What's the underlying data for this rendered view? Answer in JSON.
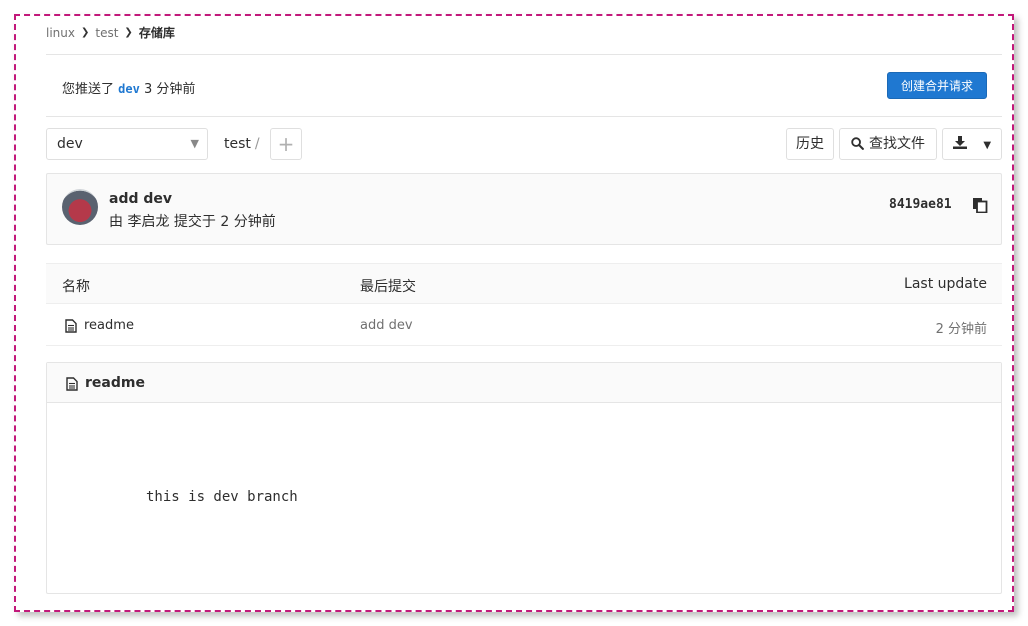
{
  "breadcrumb": {
    "items": [
      "linux",
      "test"
    ],
    "current": "存储库"
  },
  "push_notice": {
    "prefix": "您推送了",
    "branch": "dev",
    "suffix": "3 分钟前"
  },
  "merge_request_button": "创建合并请求",
  "branch_selector": {
    "value": "dev"
  },
  "path": {
    "project": "test",
    "separator": "/"
  },
  "toolbar": {
    "history": "历史",
    "find_file": "查找文件"
  },
  "icons": {
    "search": "search-icon",
    "download": "download-icon",
    "copy": "copy-icon",
    "file": "file-icon",
    "plus": "plus-icon",
    "chevron": "chevron-down-icon"
  },
  "last_commit": {
    "title": "add dev",
    "meta": "由 李启龙 提交于 2 分钟前",
    "sha": "8419ae81"
  },
  "file_table": {
    "headers": [
      "名称",
      "最后提交",
      "Last update"
    ],
    "rows": [
      {
        "name": "readme",
        "commit": "add dev",
        "updated": "2 分钟前"
      }
    ]
  },
  "readme": {
    "title": "readme",
    "content": "this is dev branch"
  },
  "colors": {
    "accent": "#1f78d1",
    "frame": "#c2187a"
  }
}
